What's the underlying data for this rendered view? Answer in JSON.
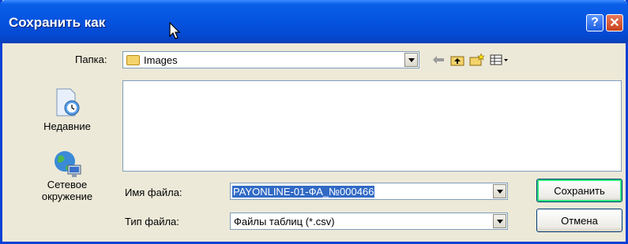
{
  "window": {
    "title": "Сохранить как",
    "help_label": "?",
    "close_label": "✕"
  },
  "folder": {
    "label": "Папка:",
    "value": "Images"
  },
  "places": [
    {
      "label": "Недавние",
      "icon": "recent-documents-icon"
    },
    {
      "label": "Сетевое окружение",
      "icon": "network-places-icon"
    }
  ],
  "filename": {
    "label": "Имя файла:",
    "value": "PAYONLINE-01-ФА_№000466"
  },
  "filetype": {
    "label": "Тип файла:",
    "value": "Файлы таблиц (*.csv)"
  },
  "buttons": {
    "save": "Сохранить",
    "cancel": "Отмена"
  },
  "toolbar": {
    "icons": [
      "back-arrow-icon",
      "up-folder-icon",
      "new-folder-icon",
      "view-menu-icon"
    ]
  },
  "colors": {
    "title_bar": "#0553e0",
    "selection": "#316ac5",
    "save_focus": "#2ee87d"
  }
}
